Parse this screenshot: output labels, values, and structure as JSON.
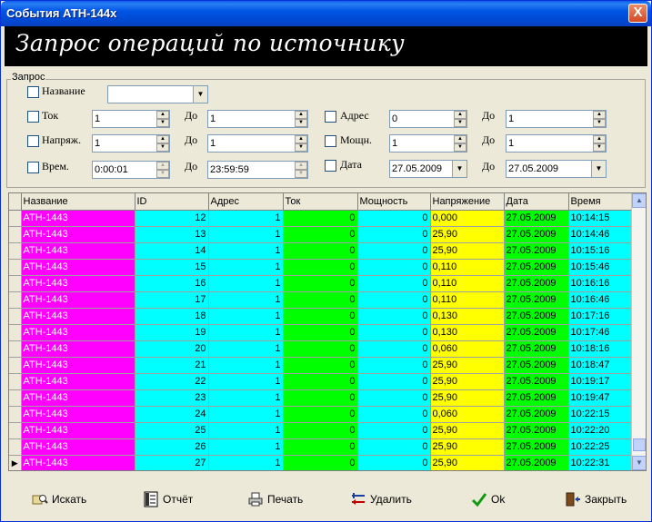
{
  "window": {
    "title": "События АТН-144х",
    "close": "X"
  },
  "header": {
    "title": "Запрос операций по источнику"
  },
  "query": {
    "legend": "Запрос",
    "name_label": "Название",
    "name_value": "",
    "to_label": "До",
    "current": {
      "label": "Ток",
      "from": "1",
      "to": "1"
    },
    "voltage": {
      "label": "Напряж.",
      "from": "1",
      "to": "1"
    },
    "time": {
      "label": "Врем.",
      "from": "0:00:01",
      "to": "23:59:59"
    },
    "address": {
      "label": "Адрес",
      "from": "0",
      "to": "1"
    },
    "power": {
      "label": "Мощн.",
      "from": "1",
      "to": "1"
    },
    "date": {
      "label": "Дата",
      "from": "27.05.2009",
      "to": "27.05.2009"
    }
  },
  "table": {
    "columns": [
      "Название",
      "ID",
      "Адрес",
      "Ток",
      "Мощность",
      "Напряжение",
      "Дата",
      "Время"
    ],
    "rows": [
      [
        "АТН-1443",
        "12",
        "1",
        "0",
        "0",
        "0,000",
        "27.05.2009",
        "10:14:15"
      ],
      [
        "АТН-1443",
        "13",
        "1",
        "0",
        "0",
        "25,90",
        "27.05.2009",
        "10:14:46"
      ],
      [
        "АТН-1443",
        "14",
        "1",
        "0",
        "0",
        "25,90",
        "27.05.2009",
        "10:15:16"
      ],
      [
        "АТН-1443",
        "15",
        "1",
        "0",
        "0",
        "0,110",
        "27.05.2009",
        "10:15:46"
      ],
      [
        "АТН-1443",
        "16",
        "1",
        "0",
        "0",
        "0,110",
        "27.05.2009",
        "10:16:16"
      ],
      [
        "АТН-1443",
        "17",
        "1",
        "0",
        "0",
        "0,110",
        "27.05.2009",
        "10:16:46"
      ],
      [
        "АТН-1443",
        "18",
        "1",
        "0",
        "0",
        "0,130",
        "27.05.2009",
        "10:17:16"
      ],
      [
        "АТН-1443",
        "19",
        "1",
        "0",
        "0",
        "0,130",
        "27.05.2009",
        "10:17:46"
      ],
      [
        "АТН-1443",
        "20",
        "1",
        "0",
        "0",
        "0,060",
        "27.05.2009",
        "10:18:16"
      ],
      [
        "АТН-1443",
        "21",
        "1",
        "0",
        "0",
        "25,90",
        "27.05.2009",
        "10:18:47"
      ],
      [
        "АТН-1443",
        "22",
        "1",
        "0",
        "0",
        "25,90",
        "27.05.2009",
        "10:19:17"
      ],
      [
        "АТН-1443",
        "23",
        "1",
        "0",
        "0",
        "25,90",
        "27.05.2009",
        "10:19:47"
      ],
      [
        "АТН-1443",
        "24",
        "1",
        "0",
        "0",
        "0,060",
        "27.05.2009",
        "10:22:15"
      ],
      [
        "АТН-1443",
        "25",
        "1",
        "0",
        "0",
        "25,90",
        "27.05.2009",
        "10:22:20"
      ],
      [
        "АТН-1443",
        "26",
        "1",
        "0",
        "0",
        "25,90",
        "27.05.2009",
        "10:22:25"
      ],
      [
        "АТН-1443",
        "27",
        "1",
        "0",
        "0",
        "25,90",
        "27.05.2009",
        "10:22:31"
      ]
    ]
  },
  "toolbar": {
    "search": "Искать",
    "report": "Отчёт",
    "print": "Печать",
    "delete": "Удалить",
    "ok": "Ok",
    "close": "Закрыть"
  },
  "colors": {
    "name_cell": "#ff00ff",
    "cyan_cell": "#00ffff",
    "green_cell": "#00ff00",
    "yellow_cell": "#ffff00"
  }
}
